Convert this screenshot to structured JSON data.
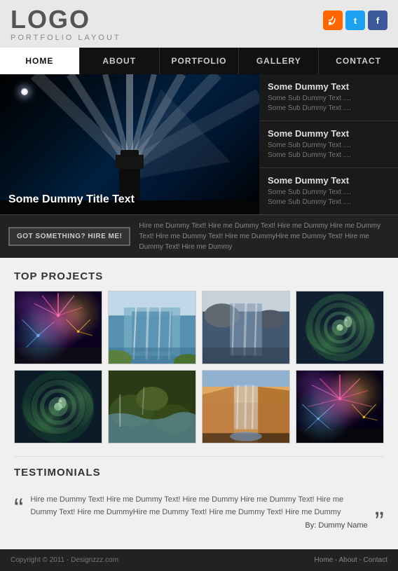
{
  "header": {
    "logo_text": "LOGO",
    "logo_sub": "PORTFOLIO LAYOUT"
  },
  "social": [
    {
      "name": "rss",
      "label": "RSS",
      "class": "social-rss"
    },
    {
      "name": "twitter",
      "label": "t",
      "class": "social-twitter"
    },
    {
      "name": "facebook",
      "label": "f",
      "class": "social-facebook"
    }
  ],
  "nav": {
    "items": [
      {
        "label": "HOME",
        "active": true
      },
      {
        "label": "ABOUT",
        "active": false
      },
      {
        "label": "PORTFOLIO",
        "active": false
      },
      {
        "label": "GALLERY",
        "active": false
      },
      {
        "label": "CONTACT",
        "active": false
      }
    ]
  },
  "hero": {
    "title": "Some Dummy Title Text",
    "panels": [
      {
        "title": "Some Dummy Text",
        "sub1": "Some Sub Dummy Text ....",
        "sub2": "Some Sub Dummy Text ...."
      },
      {
        "title": "Some Dummy Text",
        "sub1": "Some Sub Dummy Text ....",
        "sub2": "Some Sub Dummy Text ...."
      },
      {
        "title": "Some Dummy Text",
        "sub1": "Some Sub Dummy Text ....",
        "sub2": "Some Sub Dummy Text ...."
      }
    ]
  },
  "cta": {
    "button_label": "GOT SOMETHING? HIRE ME!",
    "text": "Hire me Dummy Text! Hire me Dummy Text! Hire me Dummy Hire me Dummy Text! Hire me Dummy Text! Hire me DummyHire me Dummy Text! Hire me Dummy Text! Hire me Dummy"
  },
  "projects": {
    "section_title": "TOP PROJECTS",
    "items": [
      {
        "type": "fireworks",
        "alt": "Fireworks project 1"
      },
      {
        "type": "waterfall",
        "alt": "Waterfall project 1"
      },
      {
        "type": "waterfall2",
        "alt": "Waterfall project 2"
      },
      {
        "type": "spiral",
        "alt": "Spiral project 1"
      },
      {
        "type": "spiral",
        "alt": "Spiral project 2"
      },
      {
        "type": "moss",
        "alt": "Mossy waterfall"
      },
      {
        "type": "canyon",
        "alt": "Canyon waterfall"
      },
      {
        "type": "fireworks",
        "alt": "Fireworks project 2"
      }
    ]
  },
  "testimonials": {
    "section_title": "TESTIMONIALS",
    "text": "Hire me Dummy Text! Hire me Dummy Text! Hire me Dummy Hire me Dummy Text! Hire me Dummy Text! Hire me DummyHire me Dummy Text! Hire me Dummy Text! Hire me Dummy",
    "author": "By: Dummy Name"
  },
  "footer": {
    "copyright": "Copyright © 2011 - Designzzz.com",
    "links": "Home - About - Contact"
  }
}
